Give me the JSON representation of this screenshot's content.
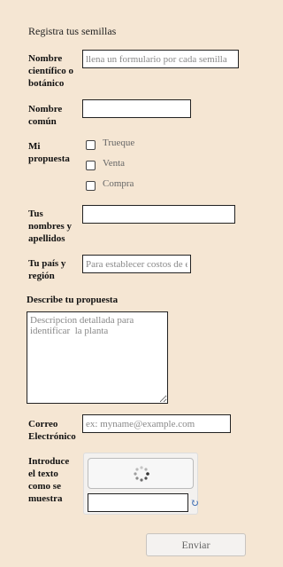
{
  "form_title": "Registra tus semillas",
  "fields": {
    "scientific_name": {
      "label": "Nombre científico o botánico",
      "placeholder": "llena un formulario por cada semilla"
    },
    "common_name": {
      "label": "Nombre común",
      "placeholder": ""
    },
    "proposal": {
      "label": "Mi propuesta",
      "options": [
        "Trueque",
        "Venta",
        "Compra"
      ]
    },
    "names": {
      "label": "Tus nombres y apellidos",
      "placeholder": ""
    },
    "country": {
      "label": "Tu país y región",
      "placeholder": "Para establecer costos de envío"
    },
    "description": {
      "label": "Describe tu propuesta",
      "placeholder": "Descripcion detallada para identificar  la planta"
    },
    "email": {
      "label": "Correo Electrónico",
      "placeholder": "ex: myname@example.com"
    },
    "captcha": {
      "label": "Introduce el texto como se muestra",
      "placeholder": ""
    }
  },
  "submit_label": "Enviar",
  "icons": {
    "loading": "spinner-icon",
    "refresh": "refresh-icon"
  },
  "colors": {
    "background": "#f5e6d3",
    "refresh": "#3c6bb0"
  }
}
